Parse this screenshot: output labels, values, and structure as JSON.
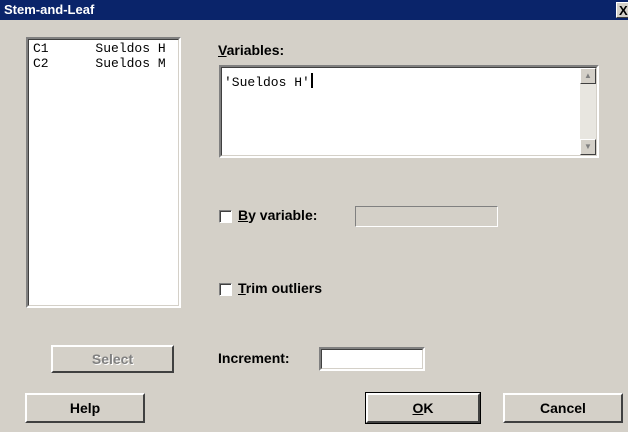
{
  "window": {
    "title": "Stem-and-Leaf",
    "close_glyph": "X"
  },
  "columns": [
    {
      "id": "C1",
      "name": "Sueldos H"
    },
    {
      "id": "C2",
      "name": "Sueldos M"
    }
  ],
  "variables": {
    "label_prefix": "V",
    "label_rest": "ariables:",
    "value": "'Sueldos H'"
  },
  "by_variable": {
    "label_prefix": "B",
    "label_rest": "y variable:",
    "checked": false,
    "value": ""
  },
  "trim_outliers": {
    "label_prefix": "T",
    "label_rest": "rim outliers",
    "checked": false
  },
  "increment": {
    "label": "Increment:",
    "value": ""
  },
  "buttons": {
    "select": "Select",
    "help": "Help",
    "ok_prefix": "O",
    "ok_rest": "K",
    "cancel": "Cancel"
  },
  "icons": {
    "scroll_up": "scroll-up-arrow-icon",
    "scroll_down": "scroll-down-arrow-icon"
  }
}
